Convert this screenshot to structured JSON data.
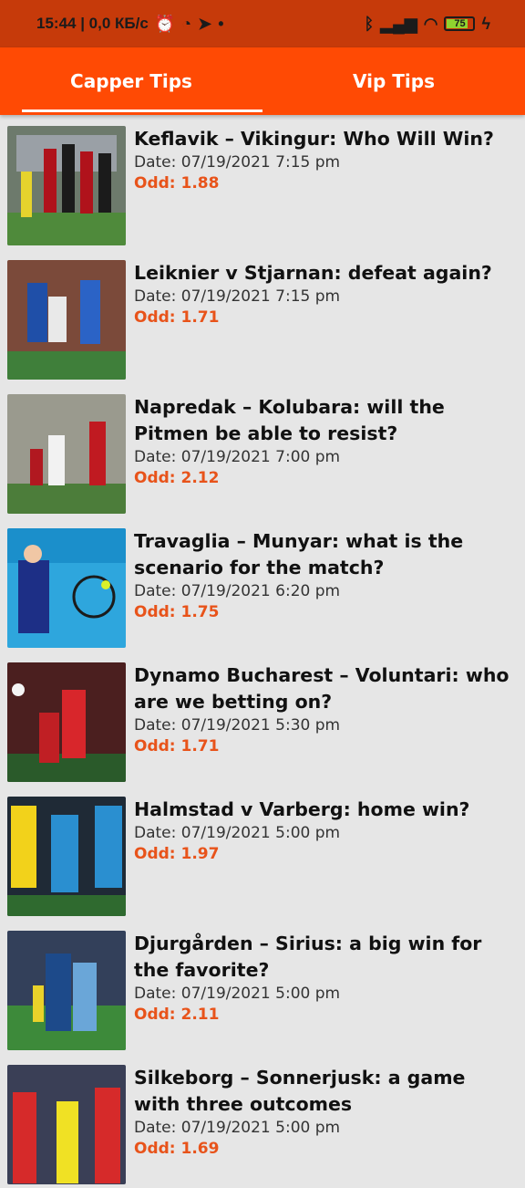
{
  "status_bar": {
    "time_speed": "15:44 | 0,0 КБ/с",
    "battery": "75",
    "icons": [
      "alarm-icon",
      "sync-icon",
      "telegram-icon",
      "dot-icon",
      "bluetooth-icon",
      "signal-icon",
      "wifi-icon",
      "battery-icon",
      "charging-icon"
    ]
  },
  "tabs": {
    "capper": "Capper Tips",
    "vip": "Vip Tips",
    "active": "capper"
  },
  "colors": {
    "status_bar": "#c63a0a",
    "tab_bar": "#ff4a04",
    "background": "#e6e6e6",
    "odd_text": "#e8531a"
  },
  "tips": [
    {
      "title": "Keflavik – Vikingur: Who Will Win?",
      "date": "Date: 07/19/2021 7:15 pm",
      "odd": "Odd: 1.88"
    },
    {
      "title": "Leiknier v Stjarnan: defeat again?",
      "date": "Date: 07/19/2021 7:15 pm",
      "odd": "Odd: 1.71"
    },
    {
      "title": "Napredak – Kolubara: will the Pitmen be able to resist?",
      "date": "Date: 07/19/2021 7:00 pm",
      "odd": "Odd: 2.12"
    },
    {
      "title": "Travaglia – Munyar: what is the scenario for the match?",
      "date": "Date: 07/19/2021 6:20 pm",
      "odd": "Odd: 1.75"
    },
    {
      "title": "Dynamo Bucharest – Voluntari: who are we betting on?",
      "date": "Date: 07/19/2021 5:30 pm",
      "odd": "Odd: 1.71"
    },
    {
      "title": "Halmstad v Varberg: home win?",
      "date": "Date: 07/19/2021 5:00 pm",
      "odd": "Odd: 1.97"
    },
    {
      "title": "Djurgården – Sirius: a big win for the favorite?",
      "date": "Date: 07/19/2021 5:00 pm",
      "odd": "Odd: 2.11"
    },
    {
      "title": "Silkeborg – Sonnerjusk: a game with three outcomes",
      "date": "Date: 07/19/2021 5:00 pm",
      "odd": "Odd: 1.69"
    }
  ]
}
